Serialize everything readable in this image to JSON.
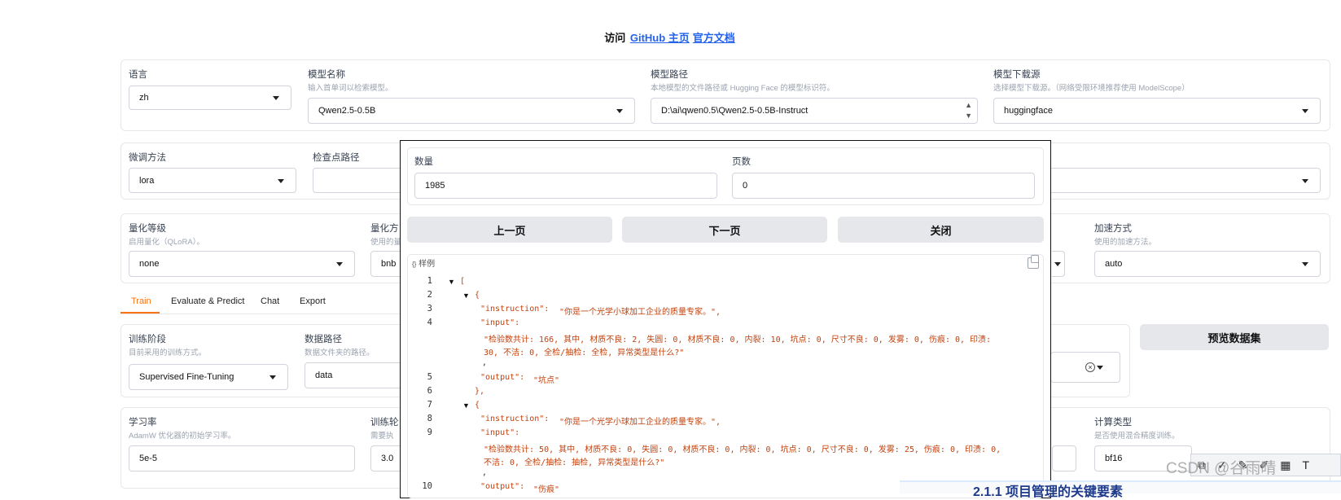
{
  "header": {
    "visit_prefix": "访问",
    "links": [
      "GitHub 主页",
      "官方文档"
    ]
  },
  "row1": {
    "language": {
      "label": "语言",
      "value": "zh"
    },
    "model_name": {
      "label": "模型名称",
      "hint": "输入首单词以检索模型。",
      "value": "Qwen2.5-0.5B"
    },
    "model_path": {
      "label": "模型路径",
      "hint": "本地模型的文件路径或 Hugging Face 的模型标识符。",
      "value": "D:\\ai\\qwen0.5\\Qwen2.5-0.5B-Instruct"
    },
    "model_source": {
      "label": "模型下载源",
      "hint": "选择模型下载源。（网络受限环境推荐使用 ModelScope）",
      "value": "huggingface"
    }
  },
  "row2": {
    "finetune": {
      "label": "微调方法",
      "value": "lora"
    },
    "checkpoint": {
      "label": "检查点路径"
    }
  },
  "row3": {
    "quant_level": {
      "label": "量化等级",
      "hint": "启用量化（QLoRA）。",
      "value": "none"
    },
    "quant_method": {
      "label": "量化方",
      "hint": "使用的量",
      "value": "bnb"
    },
    "accel": {
      "label": "加速方式",
      "hint": "使用的加速方法。",
      "value": "auto"
    }
  },
  "tabs": [
    "Train",
    "Evaluate & Predict",
    "Chat",
    "Export"
  ],
  "train": {
    "stage": {
      "label": "训练阶段",
      "hint": "目前采用的训练方式。",
      "value": "Supervised Fine-Tuning"
    },
    "data_path": {
      "label": "数据路径",
      "hint": "数据文件夹的路径。",
      "value": "data"
    },
    "preview_button": "预览数据集"
  },
  "row5": {
    "lr": {
      "label": "学习率",
      "hint": "AdamW 优化器的初始学习率。",
      "value": "5e-5"
    },
    "epochs": {
      "label": "训练轮",
      "hint": "需要执",
      "value": "3.0"
    },
    "compute": {
      "label": "计算类型",
      "hint": "是否使用混合精度训练。",
      "value": "bf16"
    }
  },
  "modal": {
    "count_label": "数量",
    "count_value": "1985",
    "page_label": "页数",
    "page_value": "0",
    "prev_button": "上一页",
    "next_button": "下一页",
    "close_button": "关闭",
    "code_tag": "样例",
    "line_numbers": [
      "1",
      "2",
      "3",
      "4",
      "5",
      "6",
      "7",
      "8",
      "9",
      "10"
    ],
    "lines": {
      "l1": "[",
      "l2": "{",
      "l3_key": "\"instruction\":",
      "l3_val": "\"你是一个光学小球加工企业的质量专家。\",",
      "l4_key": "\"input\":",
      "l4_val_a": "\"检验数共计: 166, 其中, 材质不良: 2, 失圆: 0, 材质不良: 0, 内裂: 10, 坑点: 0, 尺寸不良: 0, 发雾: 0, 伤痕: 0, 印渍:",
      "l4_val_b": "30, 不洁: 0, 全检/抽检: 全检, 异常类型是什么?\"",
      "comma": ",",
      "l5_key": "\"output\":",
      "l5_val": "\"坑点\"",
      "l6": "},",
      "l7": "{",
      "l8_key": "\"instruction\":",
      "l8_val": "\"你是一个光学小球加工企业的质量专家。\",",
      "l9_key": "\"input\":",
      "l9_val_a": "\"检验数共计: 50, 其中, 材质不良: 0, 失圆: 0, 材质不良: 0, 内裂: 0, 坑点: 0, 尺寸不良: 0, 发雾: 25, 伤痕: 0, 印渍: 0,",
      "l9_val_b": "不洁: 0, 全检/抽检: 抽检, 异常类型是什么?\"",
      "l10_key": "\"output\":",
      "l10_val": "\"伤痕\""
    }
  },
  "overlay": {
    "watermark": "CSDN @谷雨晴",
    "blue_fragment": "2.1.1 项目管理的关键要素"
  }
}
